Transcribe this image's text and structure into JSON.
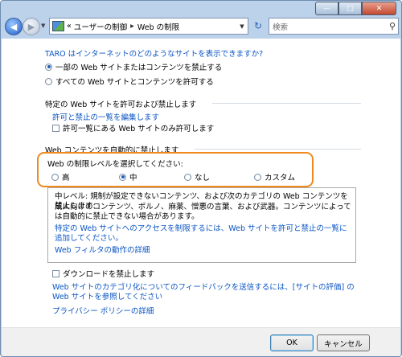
{
  "window": {
    "minimize_glyph": "—",
    "maximize_glyph": "□",
    "close_glyph": "✕"
  },
  "nav": {
    "back_glyph": "◀",
    "forward_glyph": "▶",
    "breadcrumb_prefix": "«",
    "breadcrumb_parent": "ユーザーの制御",
    "breadcrumb_separator": "▸",
    "breadcrumb_current": "Web の制限",
    "refresh_glyph": "↻",
    "search_placeholder": "検索",
    "search_icon_glyph": "⚲"
  },
  "main": {
    "question": "TARO はインターネットのどのようなサイトを表示できますか?",
    "option_block": "一部の Web サイトまたはコンテンツを禁止する",
    "option_allow_all": "すべての Web サイトとコンテンツを許可する",
    "section_specific_title": "特定の Web サイトを許可および禁止します",
    "edit_list_link": "許可と禁止の一覧を編集します",
    "allow_list_only_label": "許可一覧にある Web サイトのみ許可します",
    "section_auto_title": "Web コンテンツを自動的に禁止します",
    "level_prompt": "Web の制限レベルを選択してください:",
    "levels": [
      "高",
      "中",
      "なし",
      "カスタム"
    ],
    "selected_level": "中",
    "desc_line1": "中レベル: 規制が設定できないコンテンツ、および次のカテゴリの Web コンテンツを禁止します:",
    "desc_line2": "成人向けのコンテンツ、ポルノ、麻薬、憎悪の言葉、および武器。コンテンツによっては自動的に禁止できない場合があります。",
    "desc_link1": "特定の Web サイトへのアクセスを制限するには、Web サイトを許可と禁止の一覧に追加してください。",
    "desc_link2": "Web フィルタの動作の詳細",
    "block_downloads_label": "ダウンロードを禁止します",
    "feedback_link": "Web サイトのカテゴリ化についてのフィードバックを送信するには、[サイトの評価] の Web サイトを参照してください",
    "privacy_link": "プライバシー ポリシーの詳細"
  },
  "footer": {
    "ok_label": "OK",
    "cancel_label": "キャンセル"
  },
  "colors": {
    "link": "#0b55c4",
    "highlight_border": "#f08a1e",
    "window_frame": "#bcd2ea"
  }
}
